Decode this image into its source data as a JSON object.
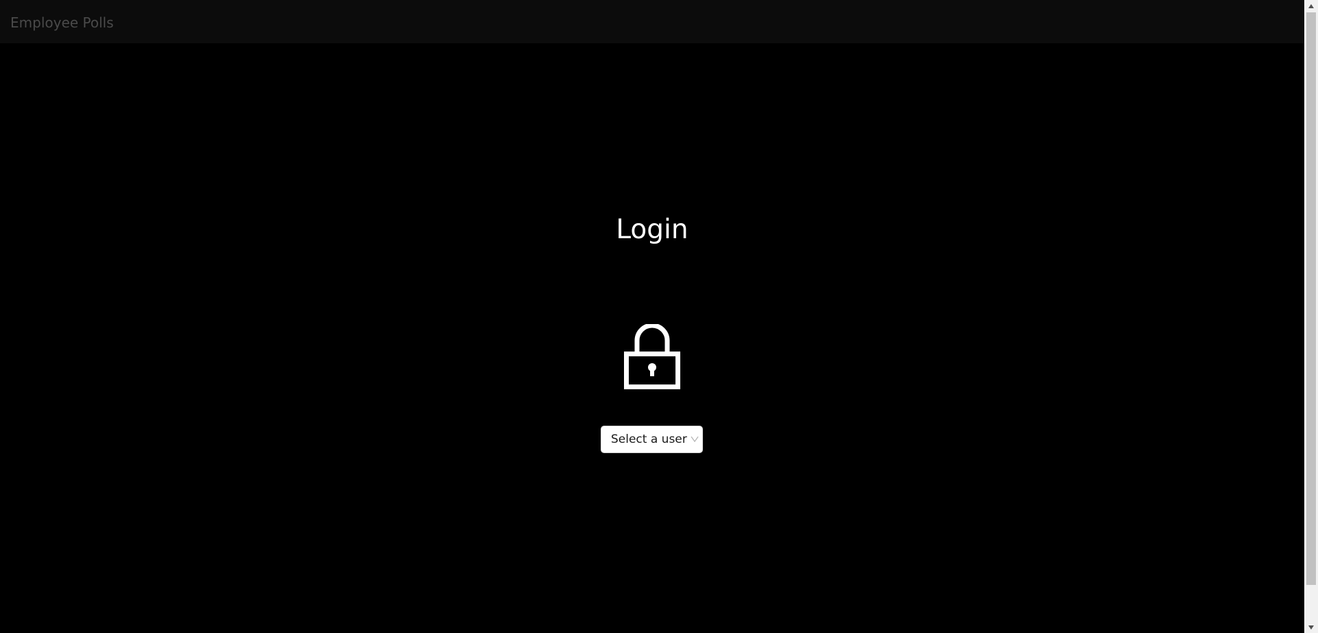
{
  "navbar": {
    "brand": "Employee Polls"
  },
  "login": {
    "title": "Login",
    "icon": "lock-icon",
    "user_select": {
      "selected_label": "Select a user"
    }
  },
  "colors": {
    "background": "#000000",
    "navbar_background": "#0c0c0c",
    "brand_text": "#4a4a4a",
    "title_text": "#ffffff",
    "scrollbar_track": "#f1f1f1",
    "scrollbar_thumb": "#c1c1c1"
  }
}
